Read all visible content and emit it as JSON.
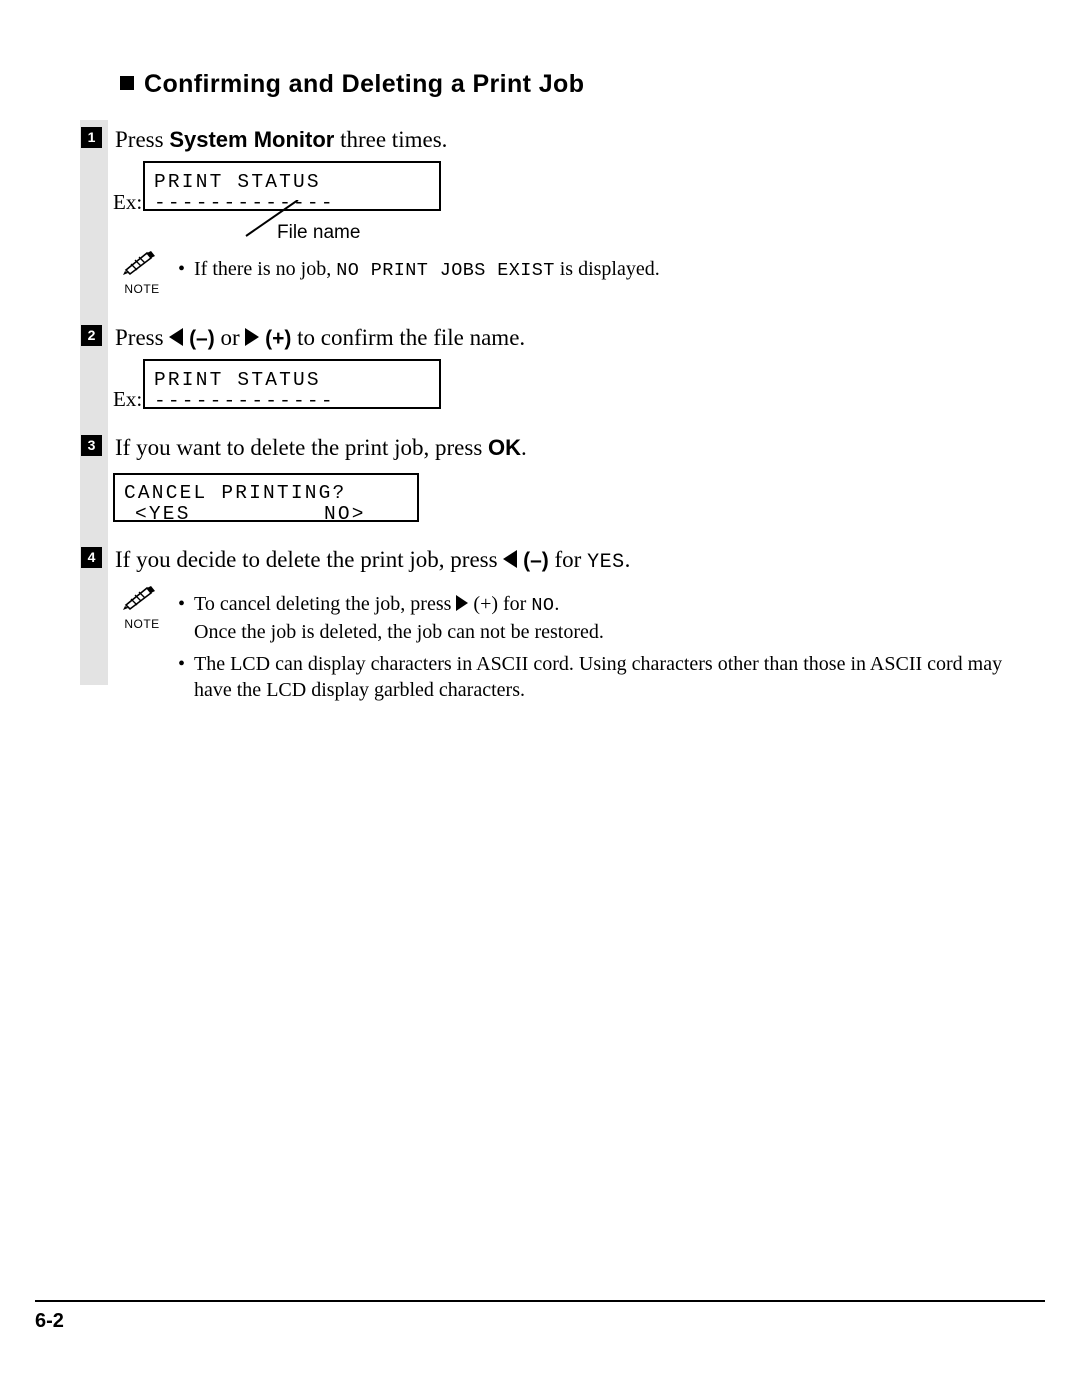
{
  "page": {
    "heading": "Confirming and Deleting a Print Job",
    "footer_page_number": "6-2"
  },
  "steps": [
    {
      "number": "1",
      "text_before": "Press ",
      "bold": "System Monitor",
      "text_after": " three times."
    },
    {
      "number": "2",
      "text_parts": {
        "press": "Press",
        "minus": "(–)",
        "or": "or",
        "plus": "(+)",
        "tail": "to confirm the file name."
      }
    },
    {
      "number": "3",
      "text_before": "If you want to delete the print job, press ",
      "bold": "OK",
      "text_after": "."
    },
    {
      "number": "4",
      "text_parts": {
        "lead": "If you decide to delete the print job, press",
        "minus": "(–)",
        "for": "for",
        "yes": "YES",
        "period": "."
      }
    }
  ],
  "lcd_displays": [
    {
      "ex_label": "Ex:",
      "line1": "PRINT STATUS",
      "line2": "-------------"
    },
    {
      "ex_label": "Ex:",
      "line1": "PRINT STATUS",
      "line2": "-------------"
    },
    {
      "line1": "CANCEL PRINTING?",
      "line2_left": "<YES",
      "line2_right": "NO>"
    }
  ],
  "callout": {
    "label": "File name"
  },
  "notes": [
    {
      "icon_label": "NOTE",
      "lines": [
        {
          "segments": [
            {
              "type": "serif",
              "text": "If there is no job, "
            },
            {
              "type": "mono",
              "text": "NO PRINT JOBS EXIST"
            },
            {
              "type": "serif",
              "text": " is displayed."
            }
          ]
        }
      ]
    },
    {
      "icon_label": "NOTE",
      "lines": [
        {
          "segments": [
            {
              "type": "serif",
              "text": "To cancel deleting the job, press "
            },
            {
              "type": "arrow-right",
              "text": ""
            },
            {
              "type": "serif",
              "text": " (+) for "
            },
            {
              "type": "mono",
              "text": "NO"
            },
            {
              "type": "serif",
              "text": "."
            }
          ]
        },
        {
          "segments": [
            {
              "type": "serif",
              "text": "Once the job is deleted, the job can not be restored."
            }
          ]
        },
        {
          "segments": [
            {
              "type": "serif",
              "text": "The LCD can display characters in ASCII cord.  Using characters other than those in ASCII cord may"
            }
          ]
        },
        {
          "segments": [
            {
              "type": "serif",
              "text": "have the LCD display garbled characters."
            }
          ]
        }
      ]
    }
  ]
}
